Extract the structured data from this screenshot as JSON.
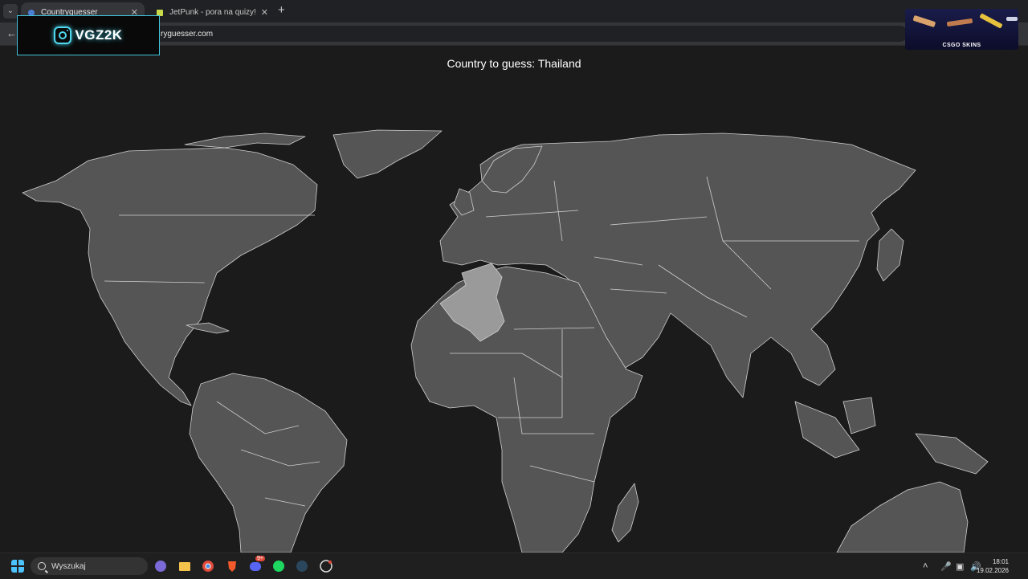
{
  "browser": {
    "tabs": [
      {
        "title": "Countryguesser",
        "active": true
      },
      {
        "title": "JetPunk - pora na quizy!",
        "active": false
      }
    ],
    "url": "ryguesser.com"
  },
  "overlays": {
    "stream_logo": "VGZ2K",
    "sponsor": "CSGO SKINS"
  },
  "game": {
    "prompt": "Country to guess: Thailand",
    "hovered_country": "Algeria"
  },
  "taskbar": {
    "search_placeholder": "Wyszukaj",
    "time": "18:01",
    "date": "19.02.2026",
    "discord_badge": "9+"
  },
  "colors": {
    "land": "#555555",
    "highlight": "#9a9a9a",
    "background": "#1b1b1b",
    "borders": "#cfcfcf"
  }
}
